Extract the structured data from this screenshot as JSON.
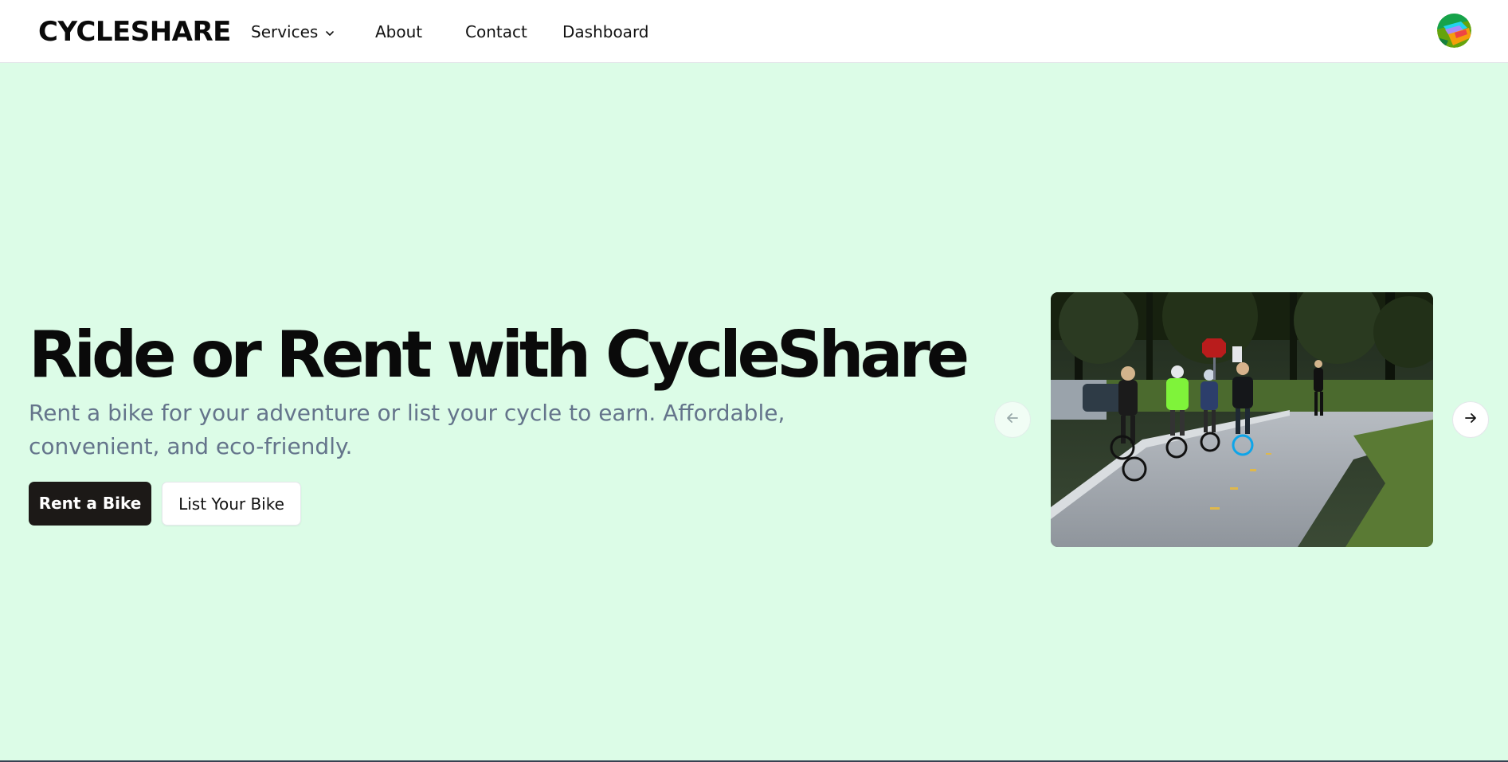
{
  "header": {
    "brand": "CYCLESHARE",
    "nav": {
      "services": "Services",
      "about": "About",
      "contact": "Contact",
      "dashboard": "Dashboard"
    },
    "avatar_icon": "user-avatar"
  },
  "hero": {
    "title": "Ride or Rent with CycleShare",
    "subtitle": "Rent a bike for your adventure or list your cycle to earn. Affordable, convenient, and eco-friendly.",
    "primary_button": "Rent a Bike",
    "secondary_button": "List Your Bike"
  },
  "carousel": {
    "prev_icon": "arrow-left-icon",
    "next_icon": "arrow-right-icon",
    "slide_image": "group of cyclists riding on a park bike path"
  },
  "colors": {
    "hero_background": "#dcfce7",
    "primary_button": "#1c1917",
    "subtitle_text": "#64748b"
  }
}
